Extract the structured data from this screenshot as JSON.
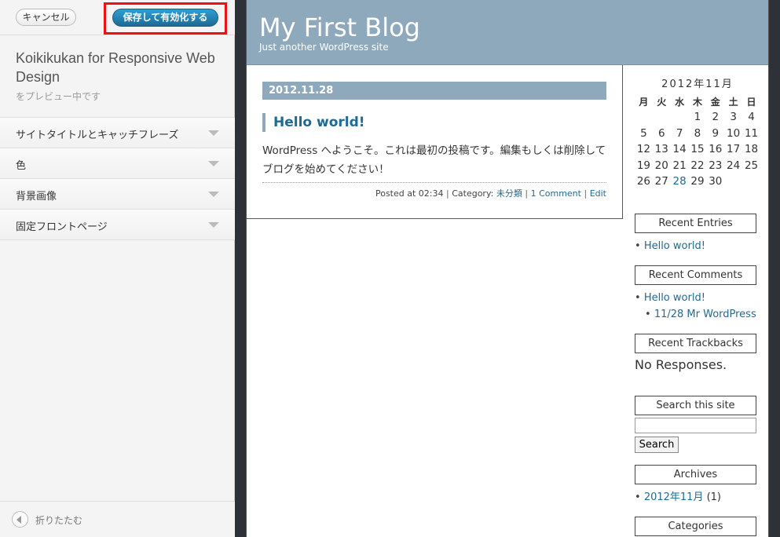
{
  "customizer": {
    "cancel_label": "キャンセル",
    "save_label": "保存して有効化する",
    "theme_name": "Koikikukan for Responsive Web Design",
    "preview_note": "をプレビュー中です",
    "sections": [
      {
        "label": "サイトタイトルとキャッチフレーズ"
      },
      {
        "label": "色"
      },
      {
        "label": "背景画像"
      },
      {
        "label": "固定フロントページ"
      }
    ],
    "collapse_label": "折りたたむ"
  },
  "blog": {
    "title": "My First Blog",
    "description": "Just another WordPress site",
    "post": {
      "date": "2012.11.28",
      "title": "Hello world!",
      "body": "WordPress へようこそ。これは最初の投稿です。編集もしくは削除してブログを始めてください！",
      "meta_posted": "Posted at 02:34",
      "meta_category_prefix": "Category:",
      "meta_category": "未分類",
      "meta_comments": "1 Comment",
      "meta_edit": "Edit",
      "separator": "|"
    },
    "calendar": {
      "caption": "2012年11月",
      "weekdays": [
        "月",
        "火",
        "水",
        "木",
        "金",
        "土",
        "日"
      ],
      "weeks": [
        [
          "",
          "",
          "",
          "1",
          "2",
          "3",
          "4"
        ],
        [
          "5",
          "6",
          "7",
          "8",
          "9",
          "10",
          "11"
        ],
        [
          "12",
          "13",
          "14",
          "15",
          "16",
          "17",
          "18"
        ],
        [
          "19",
          "20",
          "21",
          "22",
          "23",
          "24",
          "25"
        ],
        [
          "26",
          "27",
          "28",
          "29",
          "30",
          "",
          ""
        ]
      ],
      "linked_day": "28"
    },
    "widgets": {
      "recent_entries_title": "Recent Entries",
      "recent_entries": [
        "Hello world!"
      ],
      "recent_comments_title": "Recent Comments",
      "recent_comments_post": "Hello world!",
      "recent_comments_sub": "11/28 Mr WordPress",
      "recent_trackbacks_title": "Recent Trackbacks",
      "recent_trackbacks_text": "No Responses.",
      "search_title": "Search this site",
      "search_button": "Search",
      "archives_title": "Archives",
      "archives_item": "2012年11月",
      "archives_count": "(1)",
      "categories_title": "Categories"
    }
  }
}
